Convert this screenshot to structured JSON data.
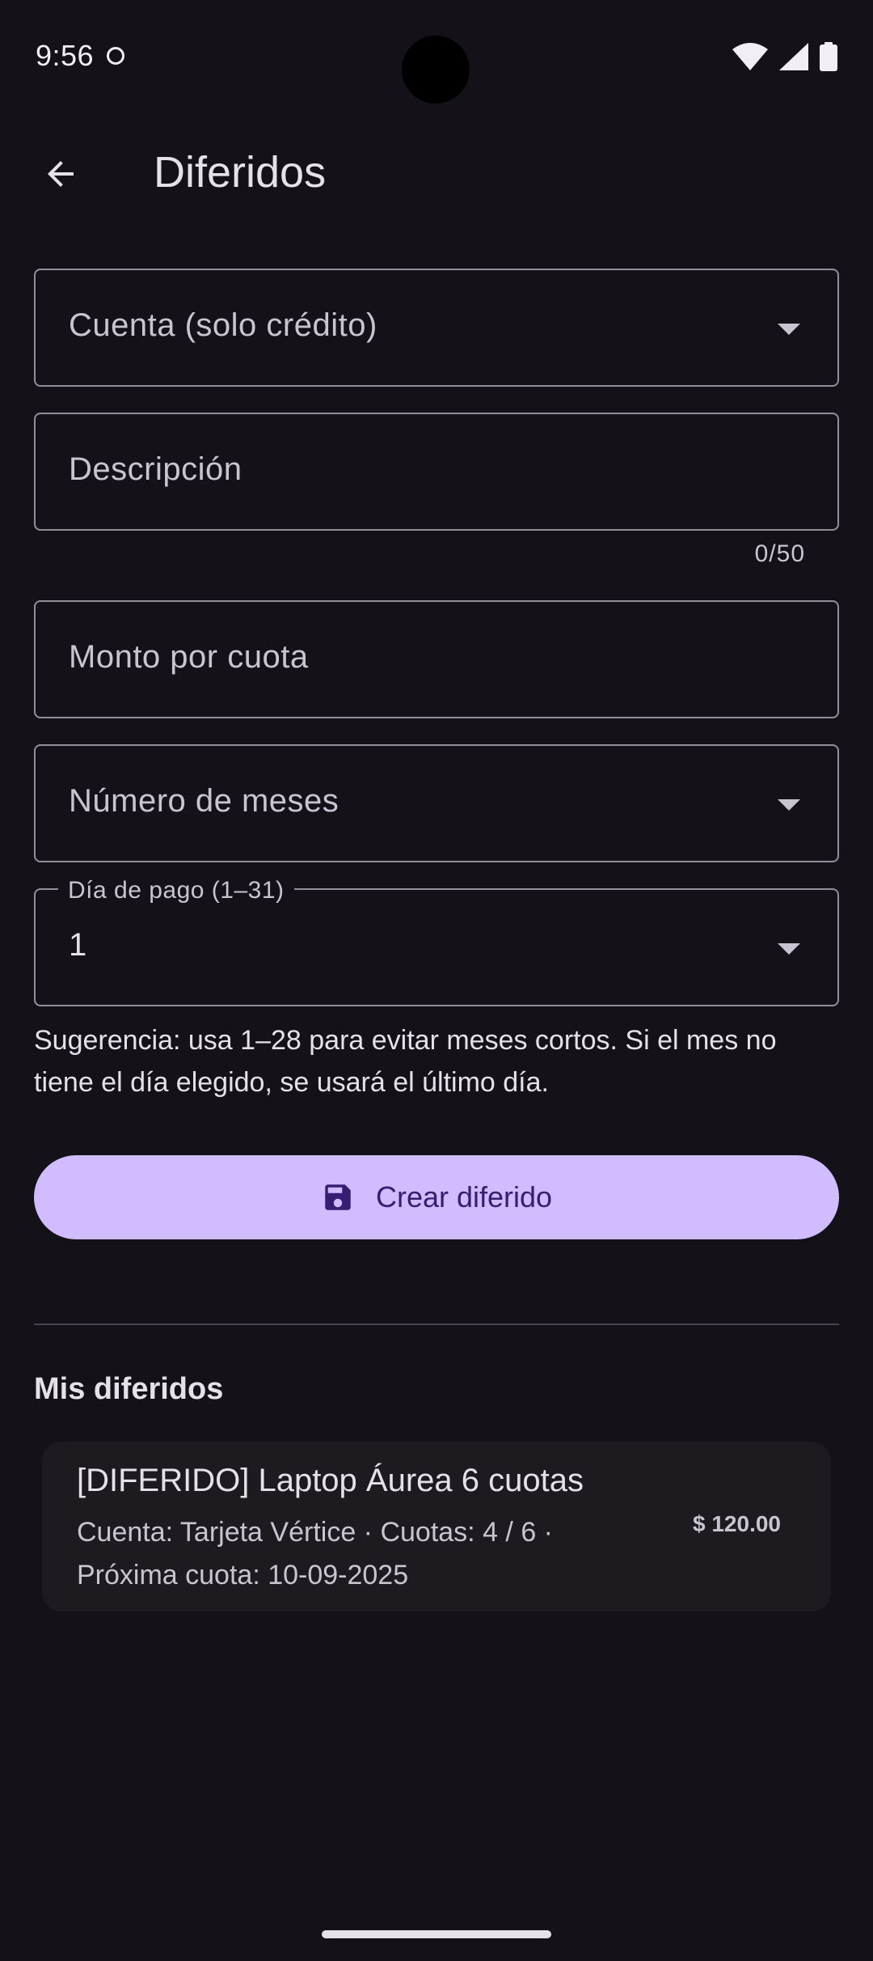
{
  "status": {
    "time": "9:56"
  },
  "app_bar": {
    "title": "Diferidos"
  },
  "form": {
    "account": {
      "placeholder": "Cuenta (solo crédito)"
    },
    "description": {
      "placeholder": "Descripción",
      "counter": "0/50"
    },
    "amount": {
      "placeholder": "Monto por cuota"
    },
    "months": {
      "placeholder": "Número de meses"
    },
    "pay_day": {
      "label": "Día de pago (1–31)",
      "value": "1"
    },
    "hint": "Sugerencia: usa 1–28 para evitar meses cortos. Si el mes no tiene el día elegido, se usará el último día.",
    "submit_label": "Crear diferido"
  },
  "list": {
    "title": "Mis diferidos",
    "items": [
      {
        "title": "[DIFERIDO] Laptop Áurea 6 cuotas",
        "subtitle": "Cuenta: Tarjeta Vértice · Cuotas: 4 / 6 · Próxima cuota: 10-09-2025",
        "amount": "$ 120.00"
      }
    ]
  },
  "colors": {
    "background": "#141218",
    "primary": "#D0BCFF",
    "on_primary": "#381E72",
    "surface": "#1D1B20",
    "outline": "#938F99"
  },
  "icons": {
    "back": "arrow-left-icon",
    "save": "floppy-disk-icon",
    "dropdown": "caret-down-icon"
  }
}
